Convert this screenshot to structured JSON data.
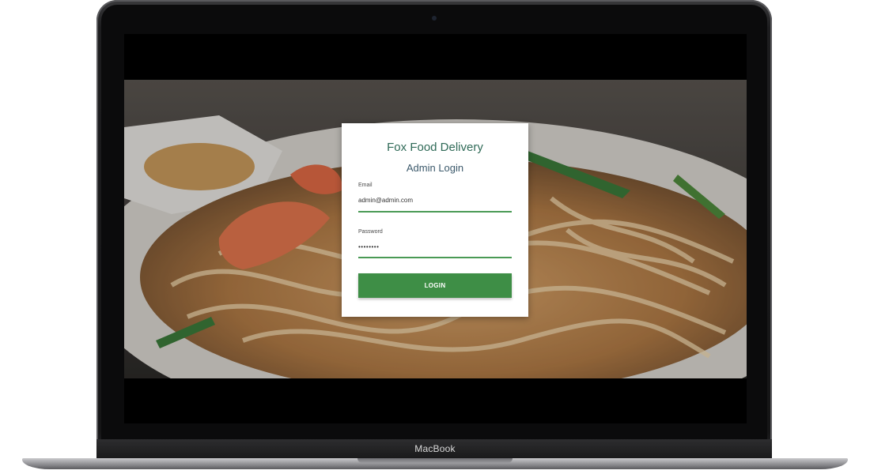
{
  "device": {
    "brand_label": "MacBook"
  },
  "login": {
    "brand_title": "Fox Food Delivery",
    "form_title": "Admin Login",
    "email_label": "Email",
    "email_value": "admin@admin.com",
    "password_label": "Password",
    "password_value": "••••••••",
    "button_label": "LOGIN"
  },
  "colors": {
    "accent_green": "#3e8e46",
    "brand_title_color": "#2f6a57"
  }
}
